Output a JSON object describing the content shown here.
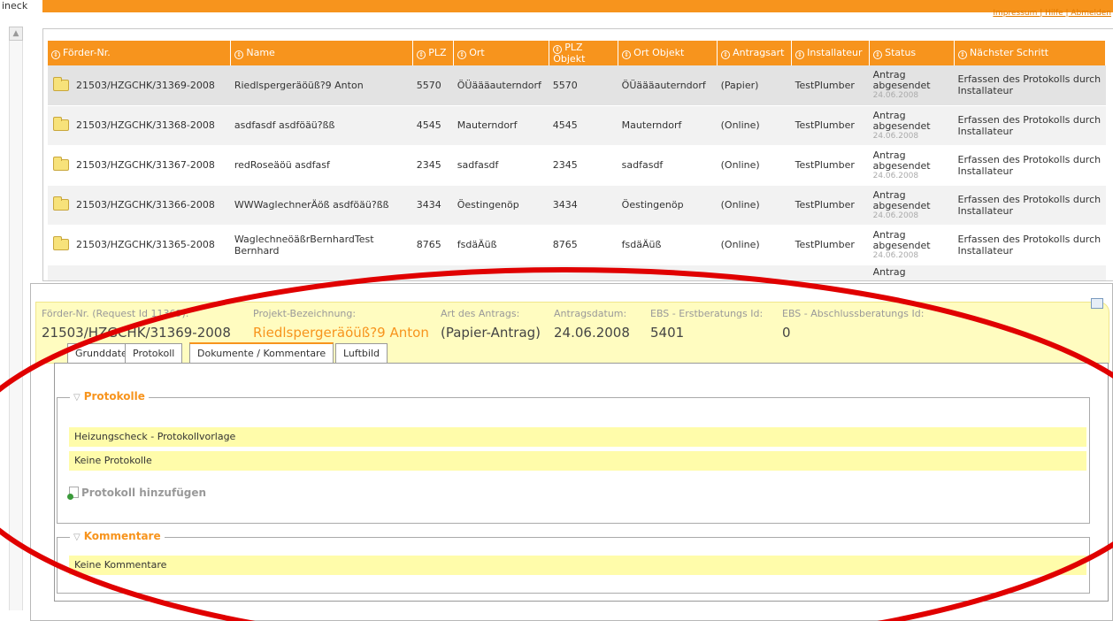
{
  "left": {
    "check_text": "ineck"
  },
  "top": {
    "links": "Impressum | Hilfe | Abmelden"
  },
  "grid": {
    "columns": [
      "Förder-Nr.",
      "Name",
      "PLZ",
      "Ort",
      "PLZ Objekt",
      "Ort Objekt",
      "Antragsart",
      "Installateur",
      "Status",
      "Nächster Schritt"
    ],
    "rows": [
      {
        "nr": "21503/HZGCHK/31369-2008",
        "name": "Riedlspergeräöüß?9 Anton",
        "plz": "5570",
        "ort": "ÖÜäääauterndorf",
        "plz_obj": "5570",
        "ort_obj": "ÖÜäääauterndorf",
        "art": "(Papier)",
        "inst": "TestPlumber",
        "status": "Antrag abgesendet",
        "date": "24.06.2008",
        "next": "Erfassen des Protokolls durch Installateur"
      },
      {
        "nr": "21503/HZGCHK/31368-2008",
        "name": "asdfasdf asdföäü?ßß",
        "plz": "4545",
        "ort": "Mauterndorf",
        "plz_obj": "4545",
        "ort_obj": "Mauterndorf",
        "art": "(Online)",
        "inst": "TestPlumber",
        "status": "Antrag abgesendet",
        "date": "24.06.2008",
        "next": "Erfassen des Protokolls durch Installateur"
      },
      {
        "nr": "21503/HZGCHK/31367-2008",
        "name": "redRoseäöü asdfasf",
        "plz": "2345",
        "ort": "sadfasdf",
        "plz_obj": "2345",
        "ort_obj": "sadfasdf",
        "art": "(Online)",
        "inst": "TestPlumber",
        "status": "Antrag abgesendet",
        "date": "24.06.2008",
        "next": "Erfassen des Protokolls durch Installateur"
      },
      {
        "nr": "21503/HZGCHK/31366-2008",
        "name": "WWWaglechnerÄöß asdföäü?ßß",
        "plz": "3434",
        "ort": "Öestingenöp",
        "plz_obj": "3434",
        "ort_obj": "Öestingenöp",
        "art": "(Online)",
        "inst": "TestPlumber",
        "status": "Antrag abgesendet",
        "date": "24.06.2008",
        "next": "Erfassen des Protokolls durch Installateur"
      },
      {
        "nr": "21503/HZGCHK/31365-2008",
        "name": "WaglechneöäßrBernhardTest Bernhard",
        "plz": "8765",
        "ort": "fsdäÄüß",
        "plz_obj": "8765",
        "ort_obj": "fsdäÄüß",
        "art": "(Online)",
        "inst": "TestPlumber",
        "status": "Antrag abgesendet",
        "date": "24.06.2008",
        "next": "Erfassen des Protokolls durch Installateur"
      },
      {
        "nr": "",
        "name": "",
        "plz": "",
        "ort": "",
        "plz_obj": "",
        "ort_obj": "",
        "art": "",
        "inst": "",
        "status": "Antrag",
        "date": "",
        "next": ""
      }
    ]
  },
  "detail": {
    "foerder_label": "Förder-Nr. (Request Id 11369):",
    "foerder_value": "21503/HZGCHK/31369-2008",
    "projekt_label": "Projekt-Bezeichnung:",
    "projekt_value": "Riedlspergeräöüß?9 Anton",
    "art_label": "Art des Antrags:",
    "art_value": "(Papier-Antrag)",
    "datum_label": "Antragsdatum:",
    "datum_value": "24.06.2008",
    "ebs1_label": "EBS - Erstberatungs Id:",
    "ebs1_value": "5401",
    "ebs2_label": "EBS - Abschlussberatungs Id:",
    "ebs2_value": "0"
  },
  "tabs": [
    "Grunddaten",
    "Protokoll",
    "Dokumente / Kommentare",
    "Luftbild"
  ],
  "protokolle": {
    "legend": "Protokolle",
    "rows": [
      "Heizungscheck - Protokollvorlage",
      "Keine Protokolle"
    ],
    "add_label": "Protokoll hinzufügen"
  },
  "kommentare": {
    "legend": "Kommentare",
    "rows": [
      "Keine Kommentare"
    ]
  },
  "colors": {
    "accent": "#f7941d",
    "highlight": "#fffcaa",
    "annotation": "#e00000"
  }
}
